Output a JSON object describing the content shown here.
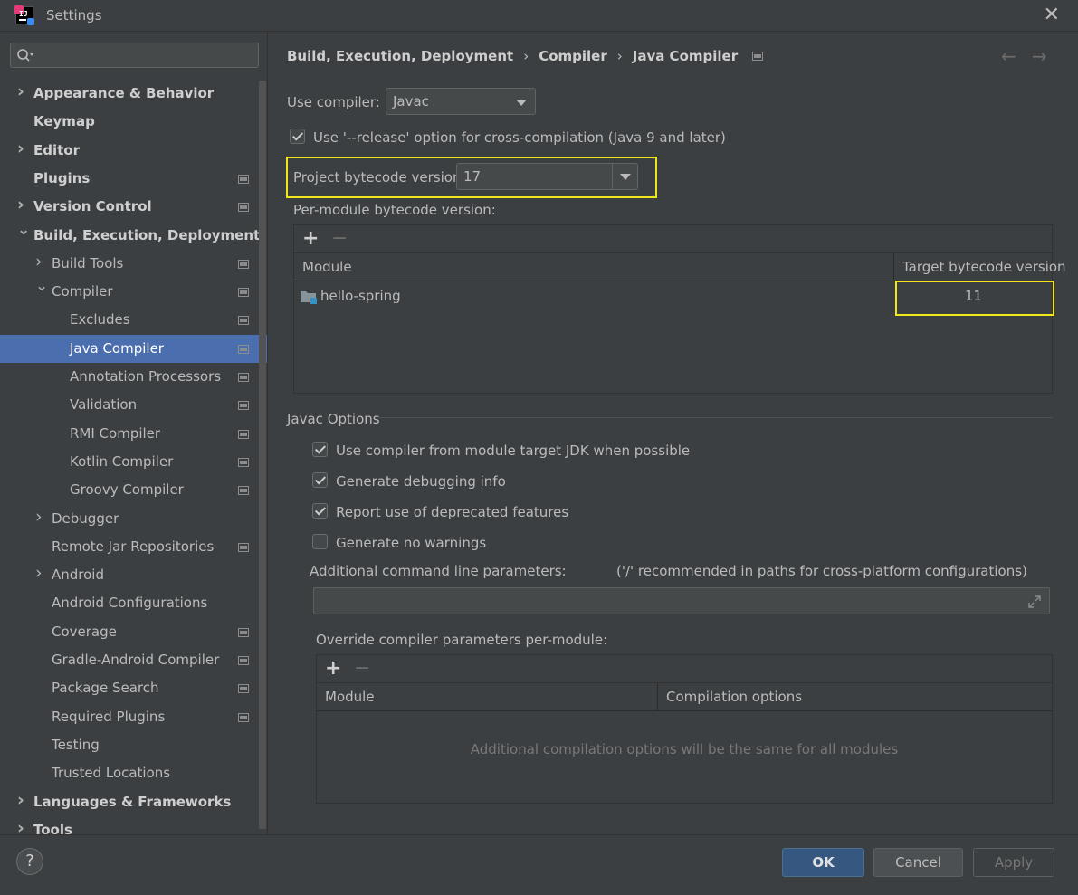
{
  "window": {
    "title": "Settings"
  },
  "colors": {
    "selection": "#4b6eaf",
    "highlight": "#f0e81a",
    "primary_button": "#365880"
  },
  "icons": {
    "app": "intellij-logo-icon",
    "search": "search-icon",
    "close": "close-icon",
    "help": "help-icon",
    "expand": "expand-icon"
  },
  "sidebar": {
    "search_placeholder": "",
    "items": [
      {
        "label": "Appearance & Behavior",
        "bold": true,
        "level": 0,
        "arrow": "right",
        "page": false
      },
      {
        "label": "Keymap",
        "bold": true,
        "level": 0,
        "arrow": "",
        "page": false
      },
      {
        "label": "Editor",
        "bold": true,
        "level": 0,
        "arrow": "right",
        "page": false
      },
      {
        "label": "Plugins",
        "bold": true,
        "level": 0,
        "arrow": "",
        "page": true
      },
      {
        "label": "Version Control",
        "bold": true,
        "level": 0,
        "arrow": "right",
        "page": true
      },
      {
        "label": "Build, Execution, Deployment",
        "bold": true,
        "level": 0,
        "arrow": "down",
        "page": false
      },
      {
        "label": "Build Tools",
        "bold": false,
        "level": 1,
        "arrow": "right",
        "page": true
      },
      {
        "label": "Compiler",
        "bold": false,
        "level": 1,
        "arrow": "down",
        "page": true
      },
      {
        "label": "Excludes",
        "bold": false,
        "level": 2,
        "arrow": "",
        "page": true
      },
      {
        "label": "Java Compiler",
        "bold": false,
        "level": 2,
        "arrow": "",
        "page": true,
        "selected": true
      },
      {
        "label": "Annotation Processors",
        "bold": false,
        "level": 2,
        "arrow": "",
        "page": true
      },
      {
        "label": "Validation",
        "bold": false,
        "level": 2,
        "arrow": "",
        "page": true
      },
      {
        "label": "RMI Compiler",
        "bold": false,
        "level": 2,
        "arrow": "",
        "page": true
      },
      {
        "label": "Kotlin Compiler",
        "bold": false,
        "level": 2,
        "arrow": "",
        "page": true
      },
      {
        "label": "Groovy Compiler",
        "bold": false,
        "level": 2,
        "arrow": "",
        "page": true
      },
      {
        "label": "Debugger",
        "bold": false,
        "level": 1,
        "arrow": "right",
        "page": false
      },
      {
        "label": "Remote Jar Repositories",
        "bold": false,
        "level": 1,
        "arrow": "",
        "page": true
      },
      {
        "label": "Android",
        "bold": false,
        "level": 1,
        "arrow": "right",
        "page": false
      },
      {
        "label": "Android Configurations",
        "bold": false,
        "level": 1,
        "arrow": "",
        "page": false
      },
      {
        "label": "Coverage",
        "bold": false,
        "level": 1,
        "arrow": "",
        "page": true
      },
      {
        "label": "Gradle-Android Compiler",
        "bold": false,
        "level": 1,
        "arrow": "",
        "page": true
      },
      {
        "label": "Package Search",
        "bold": false,
        "level": 1,
        "arrow": "",
        "page": true
      },
      {
        "label": "Required Plugins",
        "bold": false,
        "level": 1,
        "arrow": "",
        "page": true
      },
      {
        "label": "Testing",
        "bold": false,
        "level": 1,
        "arrow": "",
        "page": false
      },
      {
        "label": "Trusted Locations",
        "bold": false,
        "level": 1,
        "arrow": "",
        "page": false
      },
      {
        "label": "Languages & Frameworks",
        "bold": true,
        "level": 0,
        "arrow": "right",
        "page": false
      },
      {
        "label": "Tools",
        "bold": true,
        "level": 0,
        "arrow": "right",
        "page": false
      }
    ]
  },
  "breadcrumb": {
    "part1": "Build, Execution, Deployment",
    "part2": "Compiler",
    "part3": "Java Compiler",
    "sep": "›"
  },
  "nav": {
    "back": "←",
    "forward": "→"
  },
  "compiler": {
    "use_compiler_label": "Use compiler:",
    "use_compiler_value": "Javac",
    "release_option_label": "Use '--release' option for cross-compilation (Java 9 and later)",
    "release_option_checked": true,
    "project_bytecode_label": "Project bytecode version:",
    "project_bytecode_value": "17",
    "per_module_label": "Per-module bytecode version:",
    "per_module_table": {
      "plus": "+",
      "minus": "−",
      "columns": [
        "Module",
        "Target bytecode version"
      ],
      "rows": [
        {
          "module": "hello-spring",
          "target": "11"
        }
      ]
    }
  },
  "javac_options": {
    "section_title": "Javac Options",
    "checkboxes": [
      {
        "label": "Use compiler from module target JDK when possible",
        "checked": true
      },
      {
        "label": "Generate debugging info",
        "checked": true
      },
      {
        "label": "Report use of deprecated features",
        "checked": true
      },
      {
        "label": "Generate no warnings",
        "checked": false
      }
    ],
    "additional_params_label": "Additional command line parameters:",
    "additional_params_hint": "('/' recommended in paths for cross-platform configurations)",
    "additional_params_value": "",
    "override_label": "Override compiler parameters per-module:",
    "override_table": {
      "plus": "+",
      "minus": "−",
      "columns": [
        "Module",
        "Compilation options"
      ],
      "empty_text": "Additional compilation options will be the same for all modules"
    }
  },
  "footer": {
    "help": "?",
    "ok": "OK",
    "cancel": "Cancel",
    "apply": "Apply"
  }
}
